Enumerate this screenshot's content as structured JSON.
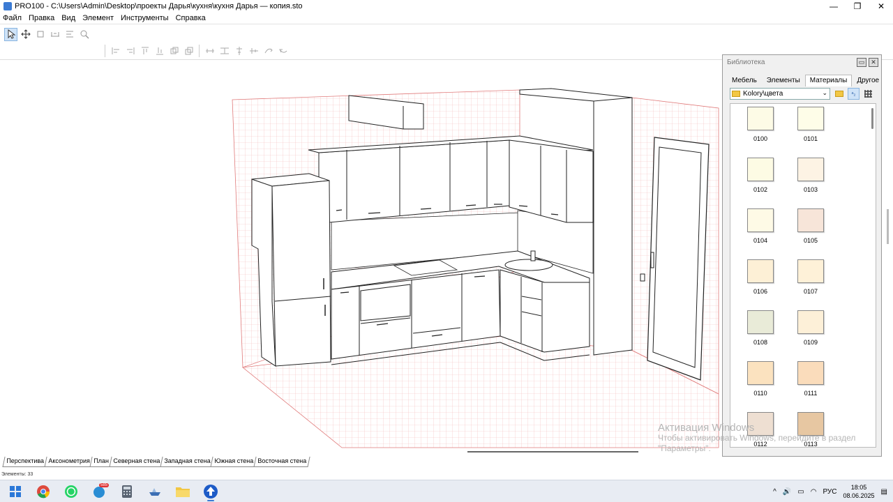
{
  "window": {
    "title": "PRO100 - C:\\Users\\Admin\\Desktop\\проекты Дарья\\кухня\\кухня Дарья  — копия.sto",
    "controls": {
      "minimize": "—",
      "maximize": "❐",
      "close": "✕"
    }
  },
  "menu": {
    "items": [
      "Файл",
      "Правка",
      "Вид",
      "Элемент",
      "Инструменты",
      "Справка"
    ]
  },
  "toolbar": {
    "tools": [
      "select-tool",
      "move-tool",
      "rotate-tool",
      "stretch-tool",
      "align-tool",
      "zoom-tool"
    ],
    "align_tools": [
      "align-left",
      "align-right",
      "align-top",
      "align-bottom",
      "align-front",
      "align-back",
      "distribute-h",
      "distribute-v",
      "center-h",
      "center-v",
      "flip-tool",
      "mirror-tool"
    ]
  },
  "library": {
    "title": "Библиотека",
    "tabs": [
      "Мебель",
      "Элементы",
      "Материалы",
      "Другое"
    ],
    "active_tab": "Материалы",
    "path": "Kolory\\цвета",
    "swatches": [
      {
        "code": "0100",
        "color": "#fdfbe6"
      },
      {
        "code": "0101",
        "color": "#fefde8"
      },
      {
        "code": "0102",
        "color": "#fdfbe4"
      },
      {
        "code": "0103",
        "color": "#fdf3e4"
      },
      {
        "code": "0104",
        "color": "#fefae6"
      },
      {
        "code": "0105",
        "color": "#f7e5d9"
      },
      {
        "code": "0106",
        "color": "#fdf0d6"
      },
      {
        "code": "0107",
        "color": "#fef1d8"
      },
      {
        "code": "0108",
        "color": "#e9ebd8"
      },
      {
        "code": "0109",
        "color": "#fdf0d8"
      },
      {
        "code": "0110",
        "color": "#fbe2bf"
      },
      {
        "code": "0111",
        "color": "#fadcbb"
      },
      {
        "code": "0112",
        "color": "#eedfd2"
      },
      {
        "code": "0113",
        "color": "#e7c7a2"
      }
    ]
  },
  "view_tabs": [
    "Перспектива",
    "Аксонометрия",
    "План",
    "Северная стена",
    "Западная стена",
    "Южная стена",
    "Восточная стена"
  ],
  "active_view": "Перспектива",
  "status": {
    "elements": "Элементы: 33"
  },
  "watermark": {
    "line1": "Активация Windows",
    "line2": "Чтобы активировать Windows, перейдите в раздел",
    "line3": "\"Параметры\"."
  },
  "taskbar": {
    "apps": [
      "windows-start",
      "chrome",
      "whatsapp",
      "app-badge",
      "calculator",
      "ship-app",
      "file-explorer",
      "pro100"
    ],
    "badge": "585",
    "tray_chevron": "^",
    "language": "РУС",
    "time": "18:05",
    "date": "08.06.2025"
  },
  "colors": {
    "grid": "#f0a0a0",
    "accent": "#3b7bd4"
  }
}
